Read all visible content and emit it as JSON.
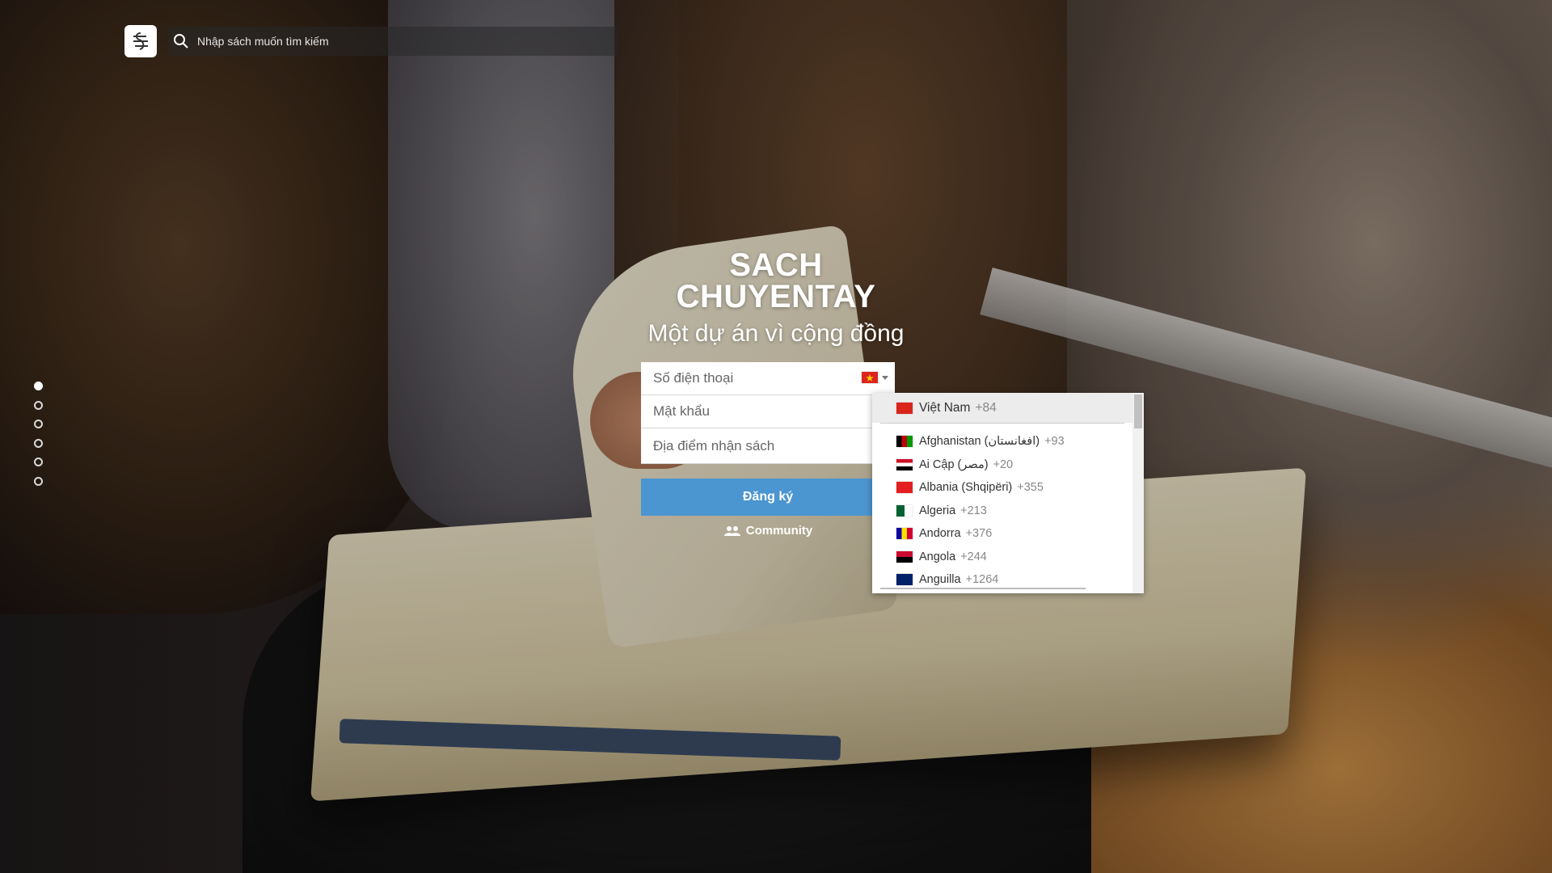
{
  "search": {
    "placeholder": "Nhập sách muốn tìm kiếm"
  },
  "hero": {
    "brand_line1": "SACH",
    "brand_line2": "CHUYENTAY",
    "tagline": "Một dự án vì cộng đồng"
  },
  "form": {
    "phone_placeholder": "Số điện thoại",
    "password_placeholder": "Mật khẩu",
    "location_placeholder": "Địa điểm nhận sách",
    "submit_label": "Đăng ký",
    "community_label": "Community"
  },
  "countries": [
    {
      "name": "Việt Nam",
      "dial": "+84",
      "flag": "vn",
      "selected": true
    },
    {
      "name": "Afghanistan (‫افغانستان‬‎)",
      "dial": "+93",
      "flag": "af"
    },
    {
      "name": "Ai Cập (‫مصر‬‎)",
      "dial": "+20",
      "flag": "eg"
    },
    {
      "name": "Albania (Shqipëri)",
      "dial": "+355",
      "flag": "al"
    },
    {
      "name": "Algeria",
      "dial": "+213",
      "flag": "dz"
    },
    {
      "name": "Andorra",
      "dial": "+376",
      "flag": "ad"
    },
    {
      "name": "Angola",
      "dial": "+244",
      "flag": "ao"
    },
    {
      "name": "Anguilla",
      "dial": "+1264",
      "flag": "ai"
    }
  ],
  "slides": {
    "count": 6,
    "active_index": 0
  },
  "colors": {
    "accent": "#4b95d1",
    "text": "#333333"
  }
}
